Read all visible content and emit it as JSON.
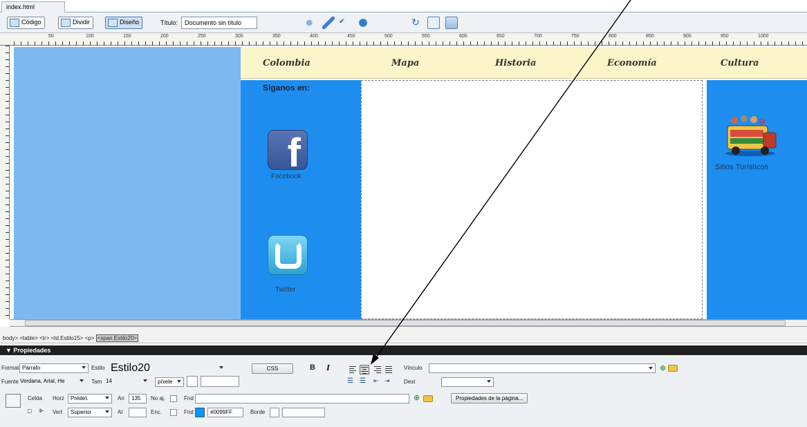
{
  "document_tab": "index.html",
  "toolbar": {
    "code_label": "Código",
    "split_label": "Dividir",
    "design_label": "Diseño",
    "title_label": "Título:",
    "title_value": "Documento sin título"
  },
  "ruler": {
    "marks": [
      "50",
      "100",
      "150",
      "200",
      "250",
      "300",
      "350",
      "400",
      "450",
      "500",
      "550",
      "600",
      "650",
      "700",
      "750",
      "800",
      "850",
      "900",
      "950",
      "1000"
    ]
  },
  "page": {
    "nav": [
      "Colombia",
      "Mapa",
      "Historia",
      "Economía",
      "Cultura"
    ],
    "social_title": "Síganos en:",
    "facebook_label": "Facebook",
    "twitter_label": "Twitter",
    "tourist_label": "Sitios Turísticos"
  },
  "tag_selector": {
    "path": "body> <table> <tr> <td.Estilo15> <p>",
    "active": "<span.Estilo20>"
  },
  "properties": {
    "header": "▼ Propiedades",
    "formato_label": "Formato",
    "formato_value": "Párrafo",
    "estilo_label": "Estilo",
    "estilo_value": "Estilo20",
    "css_label": "CSS",
    "bold_label": "B",
    "italic_label": "I",
    "vinculo_label": "Vínculo",
    "fuente_label": "Fuente",
    "fuente_value": "Verdana, Arial, He",
    "tam_label": "Tam",
    "tam_value": "14",
    "unit_value": "píxele",
    "dest_label": "Dest",
    "celda_label": "Celda",
    "horz_label": "Horz",
    "horz_value": "Predet.",
    "an_label": "An",
    "an_value": "135",
    "noaj_label": "No aj.",
    "fnd_label": "Fnd",
    "props_page_button": "Propiedades de la página...",
    "vert_label": "Vert",
    "vert_value": "Superior",
    "al_label": "Al",
    "enc_label": "Enc.",
    "fnd2_label": "Fnd",
    "bg_color_value": "#0099FF",
    "borde_label": "Borde"
  },
  "colors": {
    "left_panel": "#7db9ef",
    "blue_panel": "#1d8ef0",
    "nav_bg": "#fcf5c9",
    "cell_bg_swatch": "#0099ff"
  }
}
